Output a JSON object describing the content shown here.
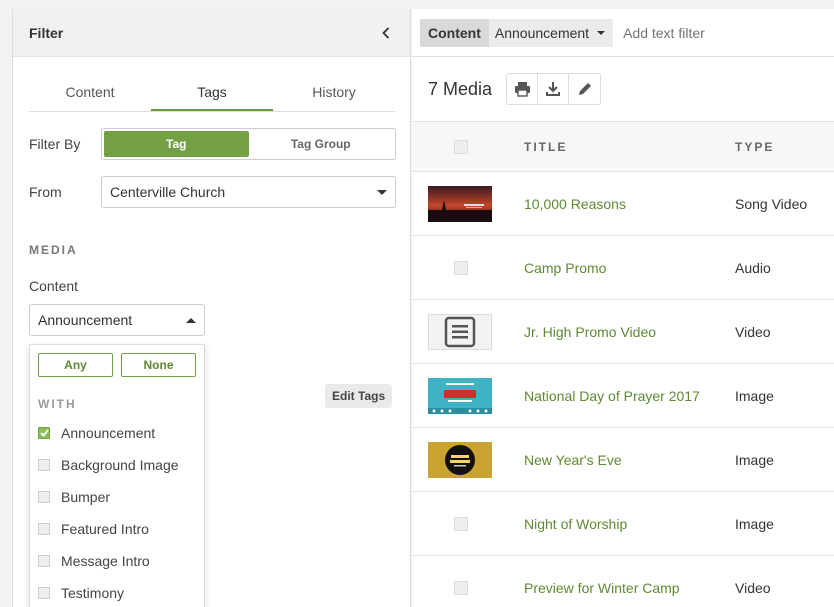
{
  "filter": {
    "title": "Filter",
    "tabs": [
      "Content",
      "Tags",
      "History"
    ],
    "active_tab": "Tags",
    "filter_by_label": "Filter By",
    "filter_by_options": [
      "Tag",
      "Tag Group"
    ],
    "filter_by_selected": "Tag",
    "from_label": "From",
    "from_value": "Centerville Church",
    "section_media": "MEDIA",
    "content_label": "Content",
    "content_value": "Announcement",
    "edit_tags_label": "Edit Tags",
    "dropdown": {
      "any_label": "Any",
      "none_label": "None",
      "with_label": "WITH",
      "items": [
        {
          "label": "Announcement",
          "checked": true
        },
        {
          "label": "Background Image",
          "checked": false
        },
        {
          "label": "Bumper",
          "checked": false
        },
        {
          "label": "Featured Intro",
          "checked": false
        },
        {
          "label": "Message Intro",
          "checked": false
        },
        {
          "label": "Testimony",
          "checked": false
        }
      ]
    }
  },
  "filterbar": {
    "chip_label": "Content",
    "chip_value": "Announcement",
    "add_placeholder": "Add text filter"
  },
  "toolbar": {
    "count": "7 Media",
    "buttons": [
      "print-icon",
      "download-icon",
      "edit-pencil-icon"
    ]
  },
  "table": {
    "columns": [
      "TITLE",
      "TYPE"
    ],
    "rows": [
      {
        "title": "10,000 Reasons",
        "type": "Song Video",
        "thumb": "sunset"
      },
      {
        "title": "Camp Promo",
        "type": "Audio",
        "thumb": "none"
      },
      {
        "title": "Jr. High Promo Video",
        "type": "Video",
        "thumb": "doc"
      },
      {
        "title": "National Day of Prayer 2017",
        "type": "Image",
        "thumb": "prayer"
      },
      {
        "title": "New Year's Eve",
        "type": "Image",
        "thumb": "newyear"
      },
      {
        "title": "Night of Worship",
        "type": "Image",
        "thumb": "none"
      },
      {
        "title": "Preview for Winter Camp",
        "type": "Video",
        "thumb": "none"
      }
    ]
  },
  "colors": {
    "accent": "#72a043",
    "link": "#5d8a32"
  }
}
